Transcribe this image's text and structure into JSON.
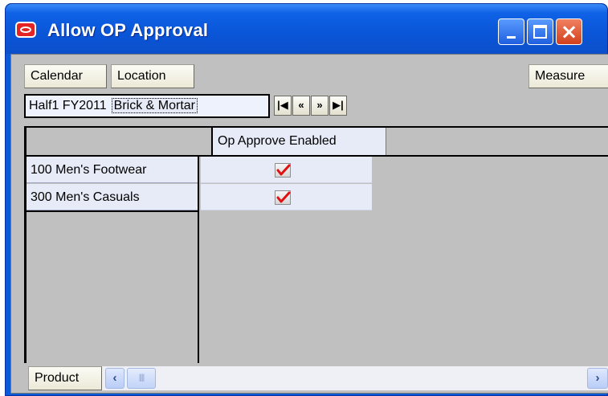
{
  "window": {
    "title": "Allow OP Approval",
    "buttons": {
      "minimize": "minimize-icon",
      "maximize": "maximize-icon",
      "close": "close-icon"
    }
  },
  "toolbar": {
    "calendar_label": "Calendar",
    "location_label": "Location",
    "measure_label": "Measure"
  },
  "page_bar": {
    "calendar_value": "Half1 FY2011",
    "location_value": "Brick & Mortar",
    "nav": {
      "first": "first-icon",
      "prev": "previous-icon",
      "next": "next-icon",
      "last": "last-icon"
    }
  },
  "grid": {
    "column_headers": [
      "Op Approve Enabled"
    ],
    "rows": [
      {
        "label": "100 Men's Footwear",
        "op_approve_enabled": true
      },
      {
        "label": "300 Men's Casuals",
        "op_approve_enabled": true
      }
    ]
  },
  "bottom": {
    "product_label": "Product"
  },
  "colors": {
    "titlebar": "#0a55d8",
    "client_bg": "#c0c0c0",
    "cell_bg": "#e6ebf7",
    "check_mark": "#e01010"
  }
}
